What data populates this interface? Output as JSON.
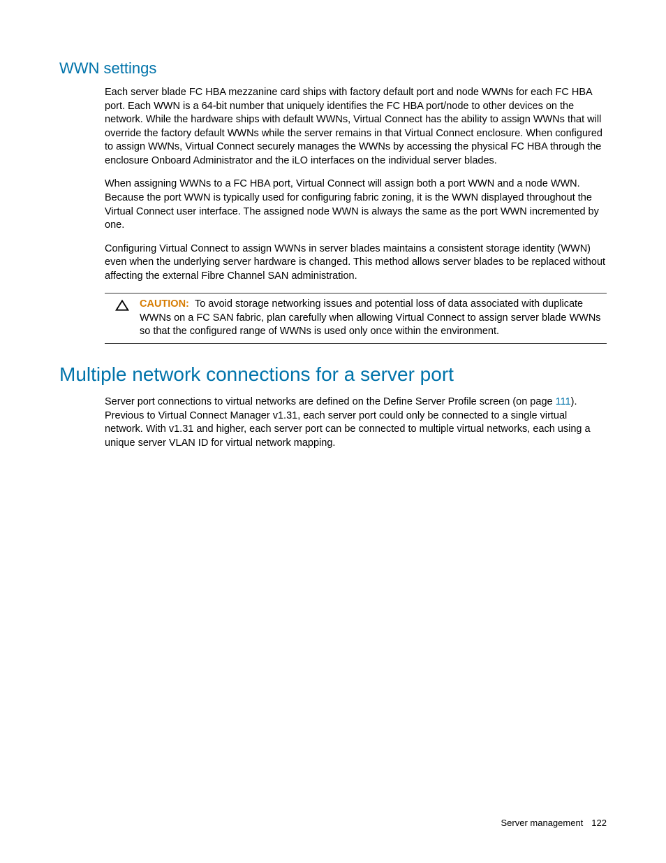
{
  "section1": {
    "heading": "WWN settings",
    "paragraph1": "Each server blade FC HBA mezzanine card ships with factory default port and node WWNs for each FC HBA port. Each WWN is a 64-bit number that uniquely identifies the FC HBA port/node to other devices on the network. While the hardware ships with default WWNs, Virtual Connect has the ability to assign WWNs that will override the factory default WWNs while the server remains in that Virtual Connect enclosure. When configured to assign WWNs, Virtual Connect securely manages the WWNs by accessing the physical FC HBA through the enclosure Onboard Administrator and the iLO interfaces on the individual server blades.",
    "paragraph2": "When assigning WWNs to a FC HBA port, Virtual Connect will assign both a port WWN and a node WWN. Because the port WWN is typically used for configuring fabric zoning, it is the WWN displayed throughout the Virtual Connect user interface. The assigned node WWN is always the same as the port WWN incremented by one.",
    "paragraph3": "Configuring Virtual Connect to assign WWNs in server blades maintains a consistent storage identity (WWN) even when the underlying server hardware is changed. This method allows server blades to be replaced without affecting the external Fibre Channel SAN administration.",
    "caution_label": "CAUTION:",
    "caution_text": "To avoid storage networking issues and potential loss of data associated with duplicate WWNs on a FC SAN fabric, plan carefully when allowing Virtual Connect to assign server blade WWNs so that the configured range of WWNs is used only once within the environment."
  },
  "section2": {
    "heading": "Multiple network connections for a server port",
    "paragraph1_part1": "Server port connections to virtual networks are defined on the Define Server Profile screen (on page ",
    "paragraph1_link": "111",
    "paragraph1_part2": "). Previous to Virtual Connect Manager v1.31, each server port could only be connected to a single virtual network. With v1.31 and higher, each server port can be connected to multiple virtual networks, each using a unique server VLAN ID for virtual network mapping."
  },
  "footer": {
    "section": "Server management",
    "page": "122"
  }
}
